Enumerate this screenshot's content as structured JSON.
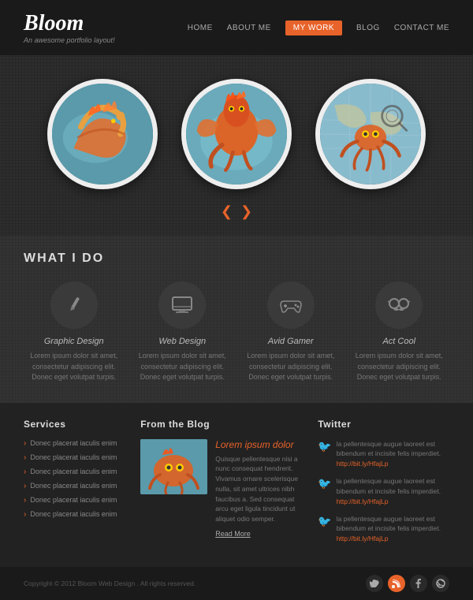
{
  "header": {
    "logo": "Bloom",
    "tagline": "An awesome portfolio layout!",
    "nav": [
      {
        "label": "HOME",
        "active": false
      },
      {
        "label": "ABOUT ME",
        "active": false
      },
      {
        "label": "MY WORK",
        "active": true
      },
      {
        "label": "BLOG",
        "active": false
      },
      {
        "label": "CONTACT ME",
        "active": false
      }
    ]
  },
  "hero": {
    "arrows": {
      "prev": "❮",
      "next": "❯"
    }
  },
  "what_i_do": {
    "title": "WHAT I DO",
    "items": [
      {
        "icon": "✏",
        "title": "Graphic Design",
        "text": "Lorem ipsum dolor sit amet, consectetur adipiscing elit. Donec eget volutpat turpis."
      },
      {
        "icon": "🖥",
        "title": "Web Design",
        "text": "Lorem ipsum dolor sit amet, consectetur adipiscing elit. Donec eget volutpat turpis."
      },
      {
        "icon": "🎮",
        "title": "Avid Gamer",
        "text": "Lorem ipsum dolor sit amet, consectetur adipiscing elit. Donec eget volutpat turpis."
      },
      {
        "icon": "😎",
        "title": "Act Cool",
        "text": "Lorem ipsum dolor sit amet, consectetur adipiscing elit. Donec eget volutpat turpis."
      }
    ]
  },
  "footer": {
    "services": {
      "title": "Services",
      "links": [
        "Donec placerat iaculis enim",
        "Donec placerat iaculis enim",
        "Donec placerat iaculis enim",
        "Donec placerat iaculis enim",
        "Donec placerat iaculis enim",
        "Donec placerat iaculis enim"
      ]
    },
    "blog": {
      "title": "From the Blog",
      "post_title": "Lorem ipsum dolor",
      "post_body": "Quisque pellentesque nisi a nunc consequat hendrerit. Vivamus ornare scelerisque nulla, sit amet ultrices nibh faucibus a. Sed consequat arcu eget ligula tincidunt ut aliquet odio semper.",
      "read_more": "Read More"
    },
    "twitter": {
      "title": "Twitter",
      "tweets": [
        {
          "text": "la pellentesque augue laoreet est bibendum et incisite felis imperdiet.",
          "link": "http://bit.ly/HfajLp"
        },
        {
          "text": "la pellentesque augue laoreet est bibendum et incisite felis imperdiet.",
          "link": "http://bit.ly/HfajLp"
        },
        {
          "text": "la pellentesque augue laoreet est bibendum et incisite felis imperdiet.",
          "link": "http://bit.ly/HfajLp"
        }
      ]
    },
    "copyright": "Copyright © 2012 Bloom Web Design . All rights reserved."
  }
}
